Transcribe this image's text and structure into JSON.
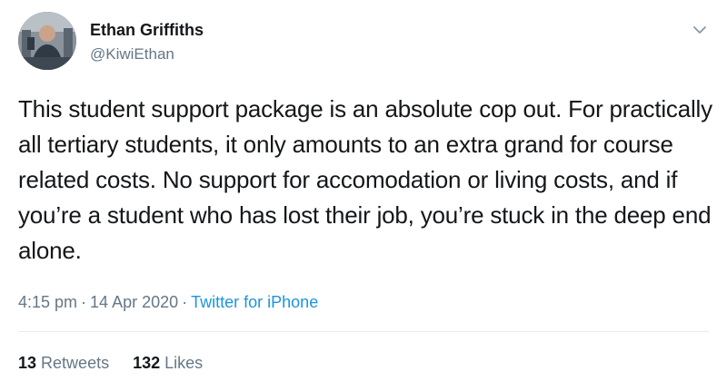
{
  "author": {
    "name": "Ethan Griffiths",
    "handle": "@KiwiEthan",
    "avatar_icon": "user-avatar-photo"
  },
  "menu_icon": "chevron-down-icon",
  "tweet": {
    "text": "This student support package is an absolute cop out. For practically all tertiary students, it only amounts to an extra grand for course related costs. No support for accomodation or living costs, and if you’re a student who has lost their job, you’re stuck in the deep end alone."
  },
  "meta": {
    "time": "4:15 pm",
    "separator": "·",
    "date": "14 Apr 2020",
    "separator2": "·",
    "source": "Twitter for iPhone"
  },
  "stats": {
    "retweets_count": "13",
    "retweets_label": "Retweets",
    "likes_count": "132",
    "likes_label": "Likes"
  },
  "colors": {
    "text": "#14171a",
    "secondary": "#657786",
    "link": "#1b95e0",
    "divider": "#e6ecf0"
  }
}
